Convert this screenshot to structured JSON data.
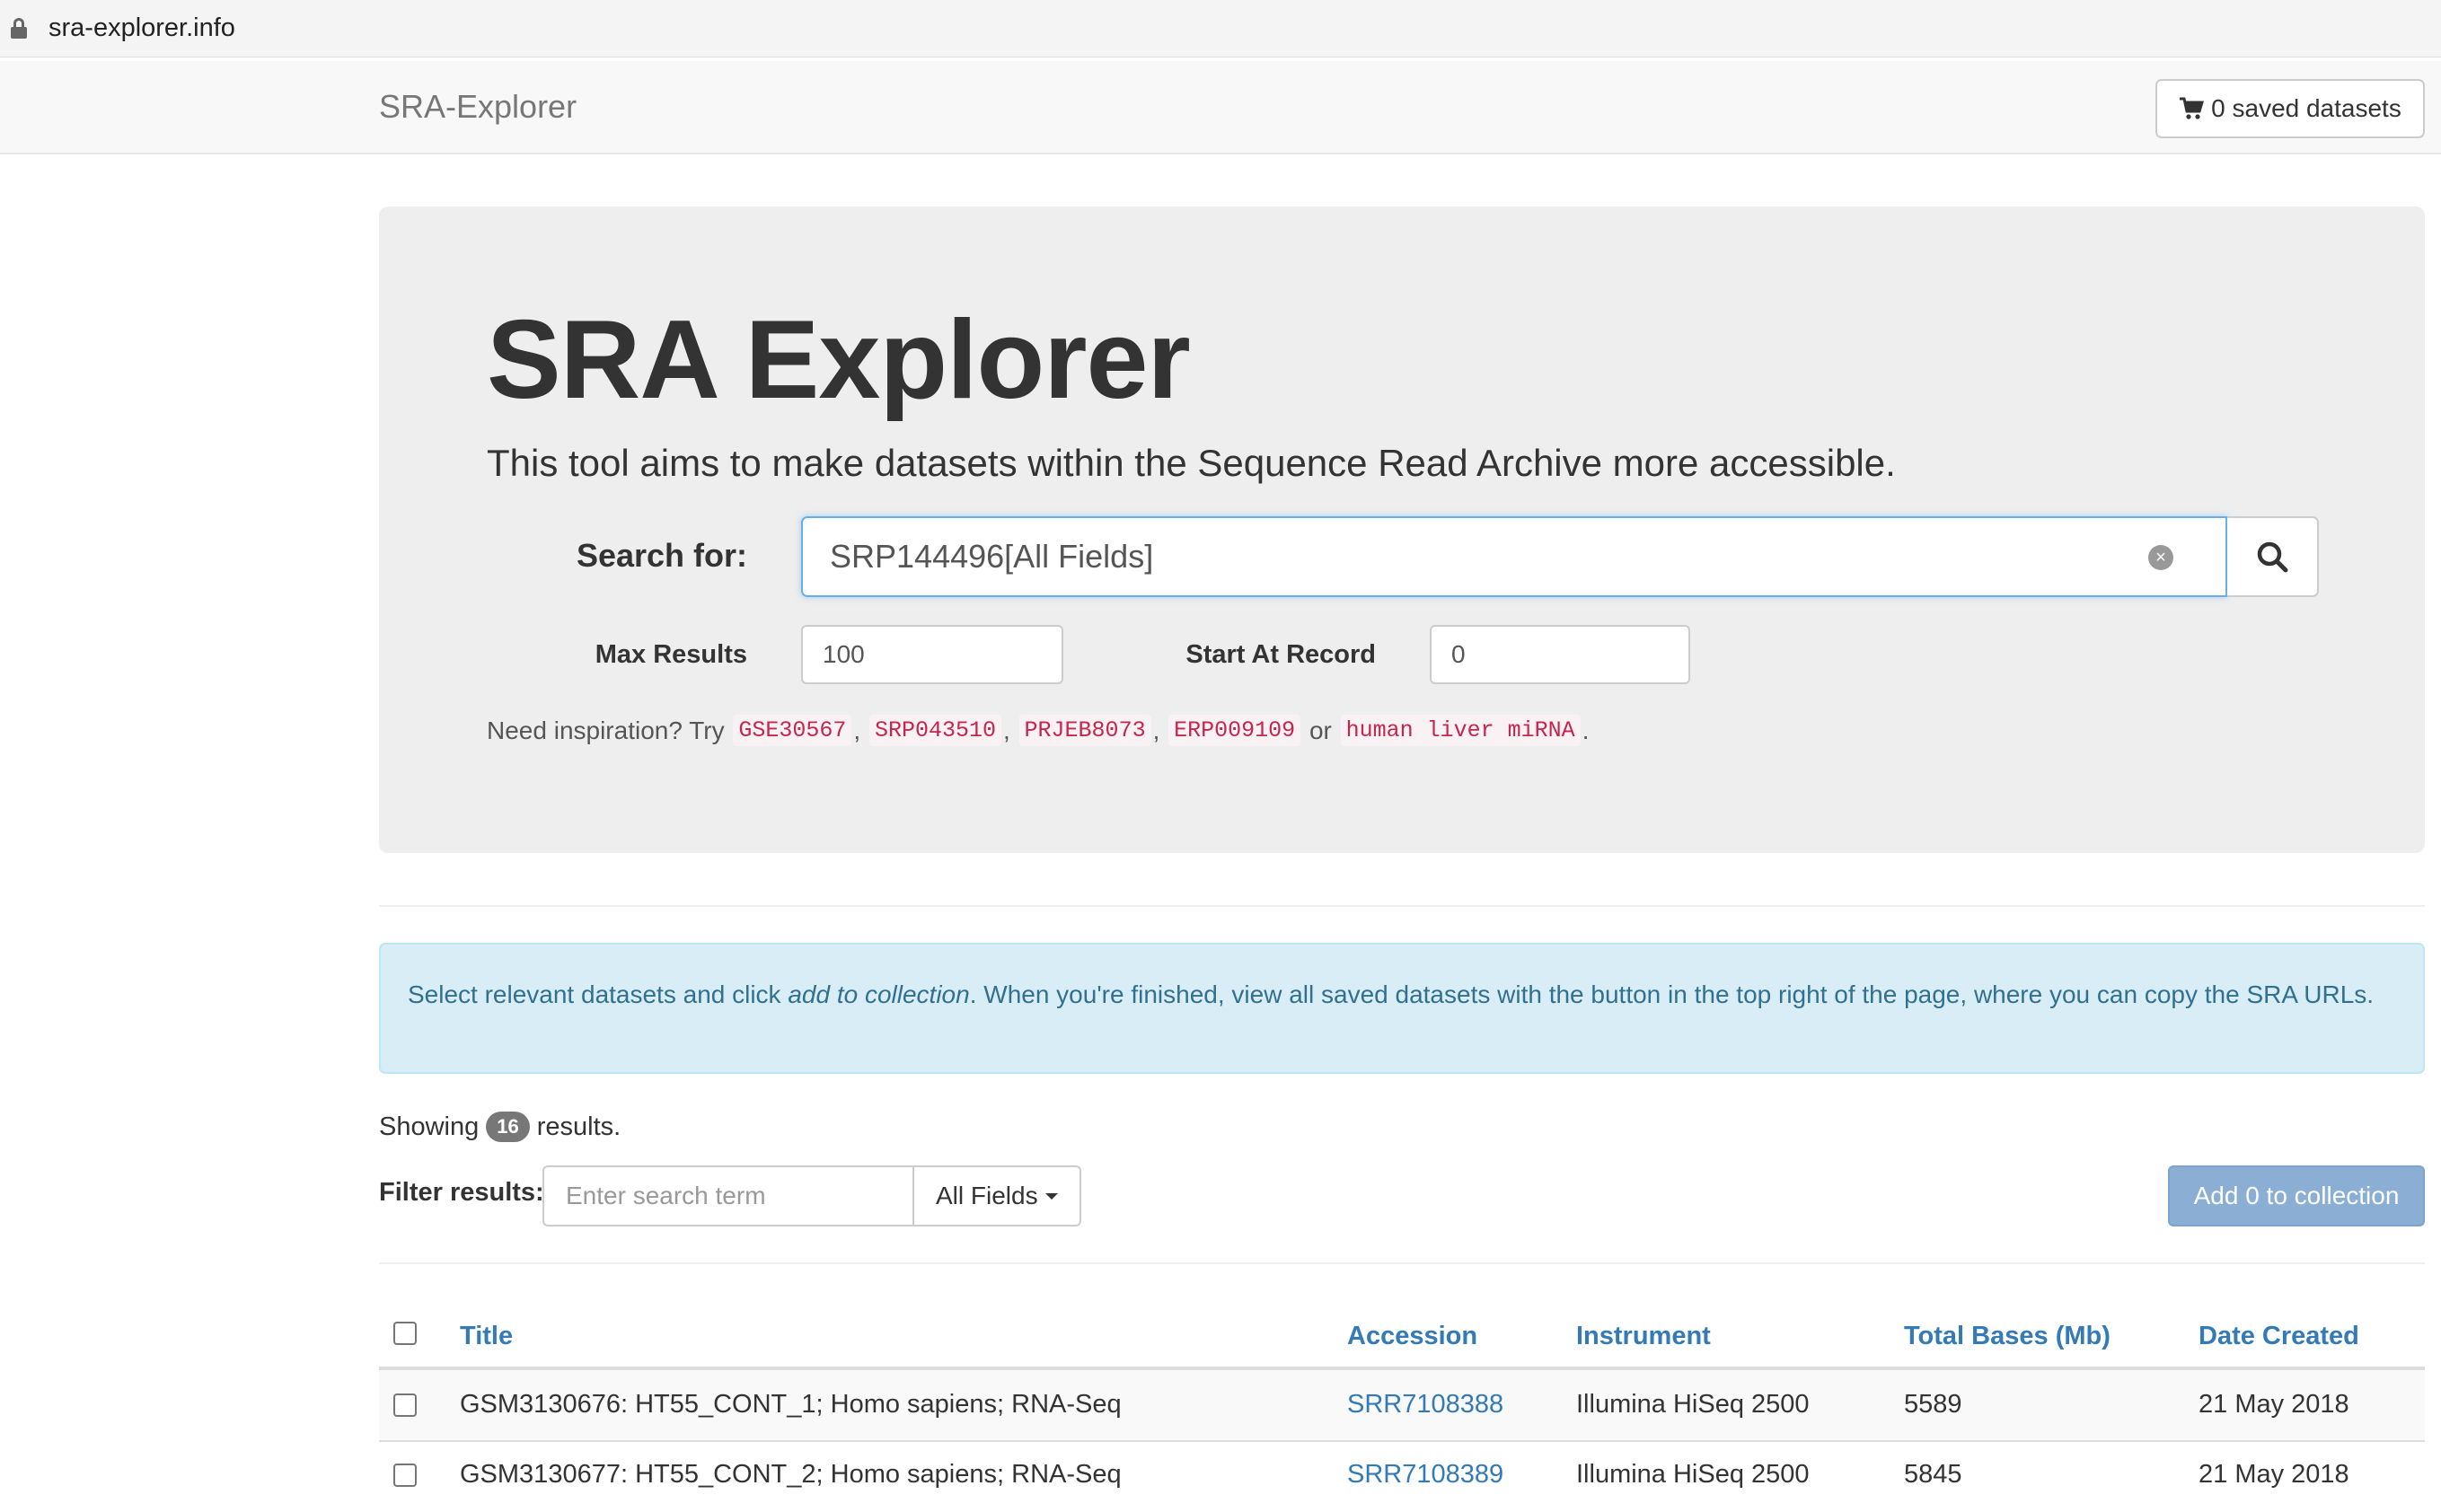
{
  "browser": {
    "url": "sra-explorer.info"
  },
  "navbar": {
    "brand": "SRA-Explorer",
    "cart_label": "0 saved datasets"
  },
  "jumbotron": {
    "title": "SRA Explorer",
    "lead": "This tool aims to make datasets within the Sequence Read Archive more accessible.",
    "search_label": "Search for:",
    "search_value": "SRP144496[All Fields]",
    "max_results_label": "Max Results",
    "max_results_value": "100",
    "start_label": "Start At Record",
    "start_value": "0",
    "inspiration_prefix": "Need inspiration? Try",
    "examples": [
      "GSE30567",
      "SRP043510",
      "PRJEB8073",
      "ERP009109",
      "human liver miRNA"
    ],
    "or_text": "or"
  },
  "alert": {
    "text_before": "Select relevant datasets and click ",
    "text_em": "add to collection",
    "text_after": ". When you're finished, view all saved datasets with the button in the top right of the page, where you can copy the SRA URLs."
  },
  "results": {
    "showing_prefix": "Showing",
    "count": "16",
    "showing_suffix": "results.",
    "filter_label": "Filter results:",
    "filter_placeholder": "Enter search term",
    "filter_field": "All Fields",
    "add_button": "Add 0 to collection"
  },
  "table": {
    "columns": [
      "Title",
      "Accession",
      "Instrument",
      "Total Bases (Mb)",
      "Date Created"
    ],
    "rows": [
      {
        "title": "GSM3130676: HT55_CONT_1; Homo sapiens; RNA-Seq",
        "accession": "SRR7108388",
        "instrument": "Illumina HiSeq 2500",
        "bases": "5589",
        "date": "21 May 2018"
      },
      {
        "title": "GSM3130677: HT55_CONT_2; Homo sapiens; RNA-Seq",
        "accession": "SRR7108389",
        "instrument": "Illumina HiSeq 2500",
        "bases": "5845",
        "date": "21 May 2018"
      }
    ]
  }
}
